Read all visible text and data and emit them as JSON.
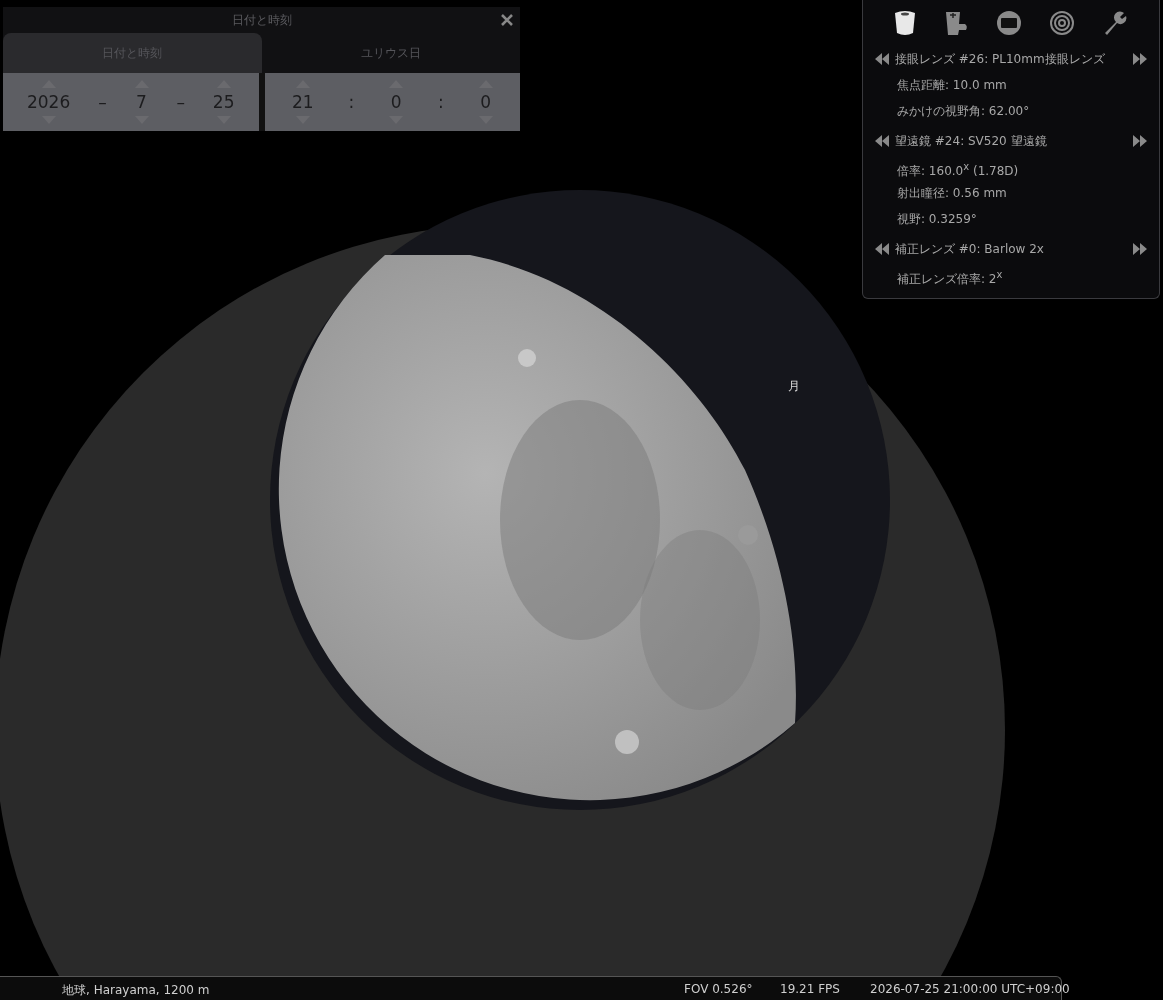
{
  "sky": {
    "object_label": "月"
  },
  "date_time_window": {
    "title": "日付と時刻",
    "tabs": [
      {
        "label": "日付と時刻",
        "selected": true
      },
      {
        "label": "ユリウス日",
        "selected": false
      }
    ],
    "date_fields": [
      "2026",
      "7",
      "25"
    ],
    "date_separators": [
      "–",
      "–"
    ],
    "time_fields": [
      "21",
      "0",
      "0"
    ],
    "time_separators": [
      ":",
      ":"
    ]
  },
  "oculars_panel": {
    "toolbar": [
      {
        "selected": true
      },
      {
        "selected": false
      },
      {
        "selected": false
      },
      {
        "selected": false
      },
      {
        "selected": false
      }
    ],
    "sections": [
      {
        "title": "接眼レンズ #26: PL10mm接眼レンズ",
        "details": [
          "焦点距離: 10.0 mm",
          "みかけの視野角: 62.00°"
        ]
      },
      {
        "title": "望遠鏡 #24: SV520 望遠鏡",
        "details": [
          "倍率: 160.0$^{x}$ (1.78D)",
          "射出瞳径: 0.56 mm",
          "視野: 0.3259°"
        ]
      },
      {
        "title": "補正レンズ #0: Barlow 2x",
        "details": [
          "補正レンズ倍率: 2$^{x}$"
        ]
      }
    ]
  },
  "status_bar": {
    "location": "地球, Harayama, 1200 m",
    "fov": "FOV 0.526°",
    "fps": "19.21 FPS",
    "datetime": "2026-07-25 21:00:00 UTC+09:00"
  }
}
